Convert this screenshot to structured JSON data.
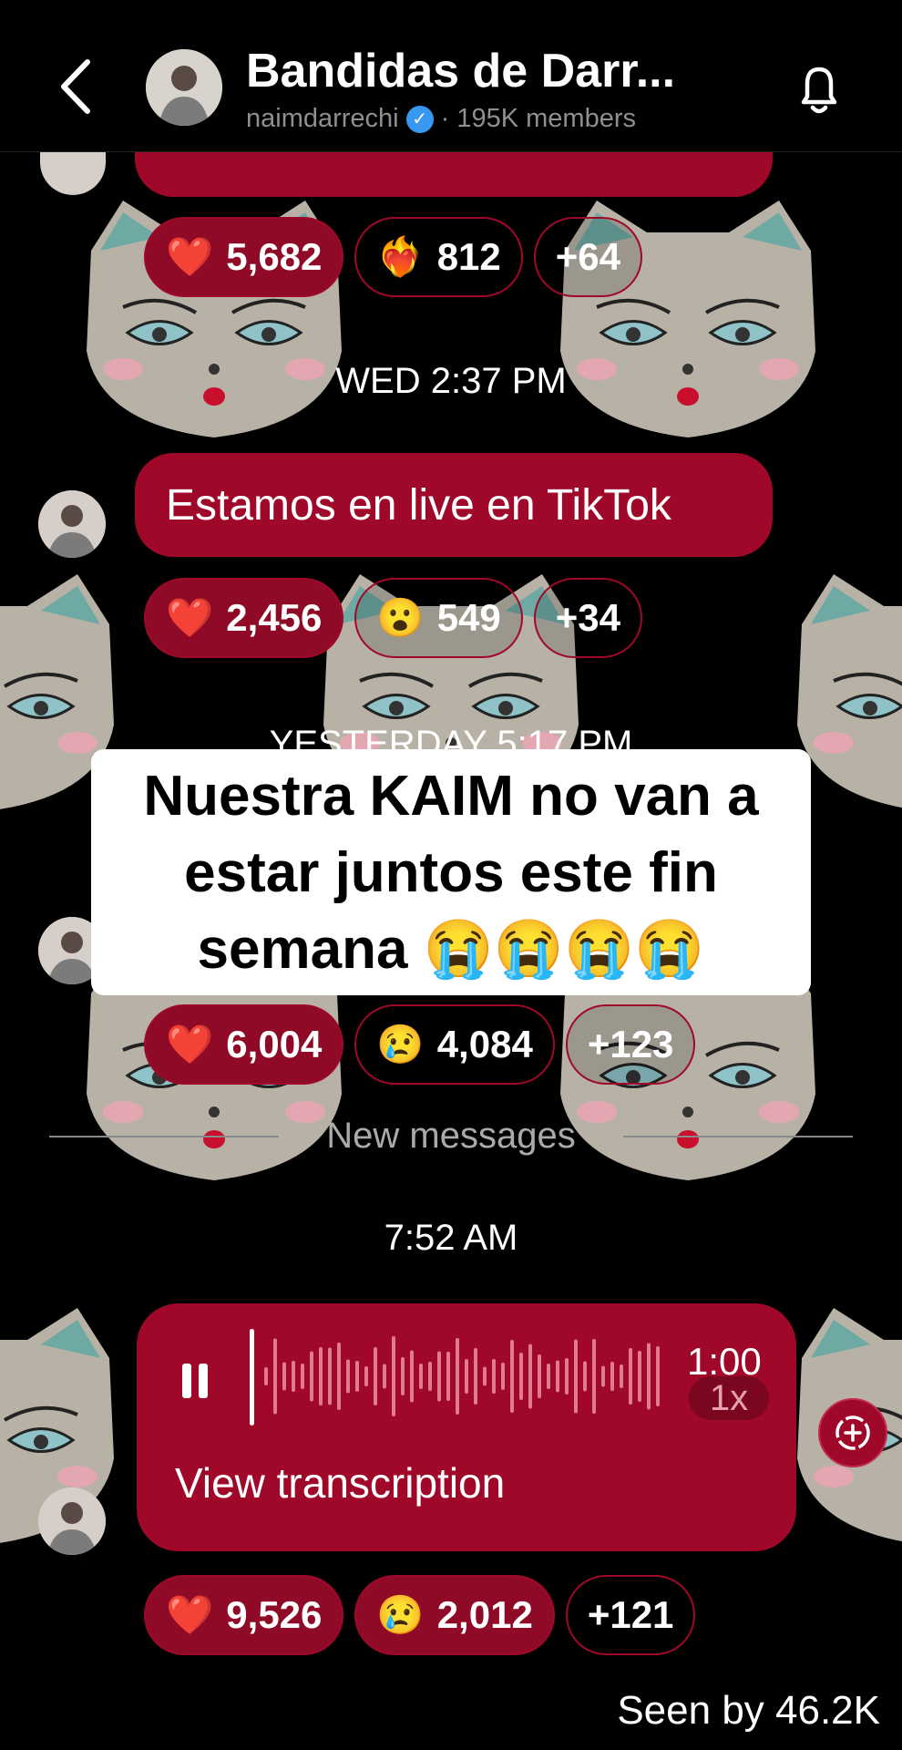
{
  "header": {
    "title": "Bandidas de Darr...",
    "username": "naimdarrechi",
    "member_text": "· 195K members"
  },
  "messages": {
    "top_reactions": [
      {
        "emoji": "❤️",
        "count": "5,682"
      },
      {
        "emoji": "❤️‍🔥",
        "count": "812"
      },
      {
        "emoji": "",
        "count": "+64"
      }
    ],
    "timestamp_wed": "WED 2:37 PM",
    "live_text": "Estamos en live en TikTok",
    "live_reactions": [
      {
        "emoji": "❤️",
        "count": "2,456"
      },
      {
        "emoji": "😮",
        "count": "549"
      },
      {
        "emoji": "",
        "count": "+34"
      }
    ],
    "timestamp_yesterday": "YESTERDAY 5:17 PM",
    "yesterday_reactions": [
      {
        "emoji": "❤️",
        "count": "6,004"
      },
      {
        "emoji": "😢",
        "count": "4,084"
      },
      {
        "emoji": "",
        "count": "+123"
      }
    ],
    "new_messages_label": "New messages",
    "timestamp_today": "7:52 AM",
    "voice": {
      "duration": "1:00",
      "speed": "1x",
      "transcription_label": "View transcription"
    },
    "voice_reactions": [
      {
        "emoji": "❤️",
        "count": "9,526"
      },
      {
        "emoji": "😢",
        "count": "2,012"
      },
      {
        "emoji": "",
        "count": "+121"
      }
    ],
    "seen_by": "Seen by 46.2K"
  },
  "overlay_caption": {
    "line1": "Nuestra KAIM no van a",
    "line2": "estar juntos este fin",
    "line3": "semana 😭😭😭😭"
  },
  "colors": {
    "bubble": "#a0082a",
    "background": "#000000"
  }
}
